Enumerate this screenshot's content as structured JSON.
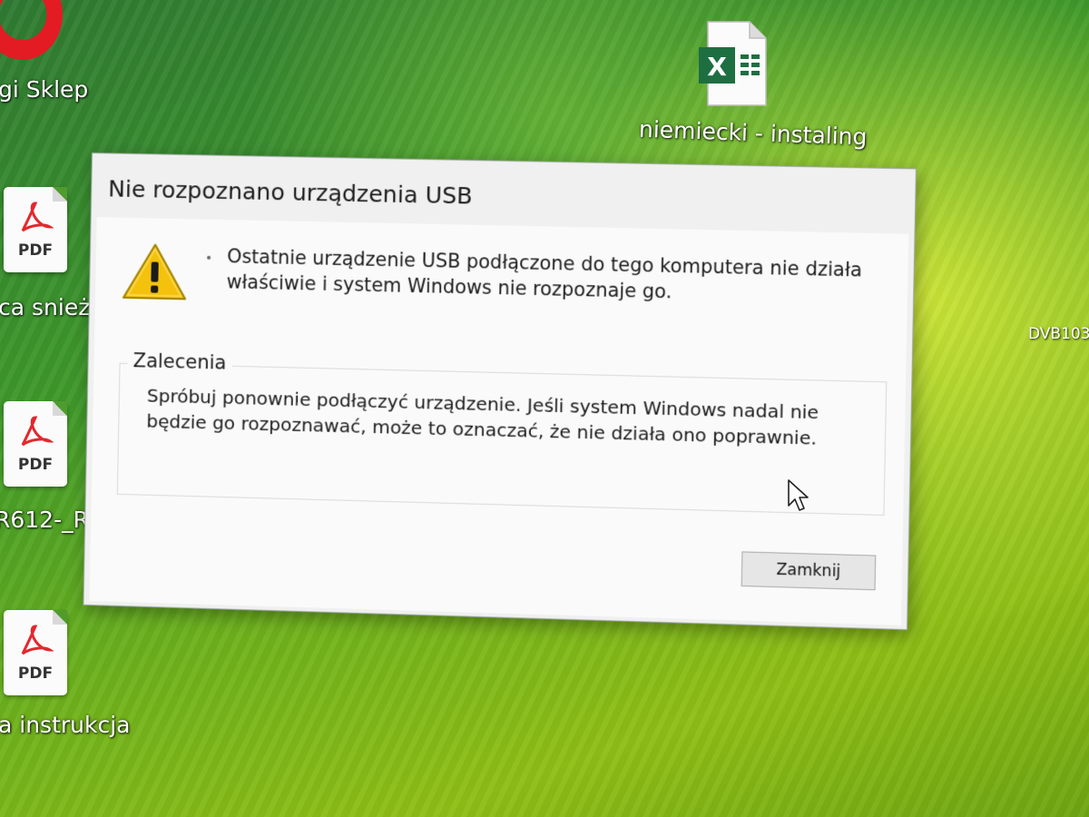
{
  "desktop": {
    "icons": [
      {
        "label": "gi Sklep"
      },
      {
        "label": "ca snież",
        "badge": "PDF"
      },
      {
        "label": "R612-_R-",
        "badge": "PDF"
      },
      {
        "label": "a instrukcja",
        "badge": "PDF"
      },
      {
        "label": "niemiecki - instaling",
        "badge": "X"
      },
      {
        "label": "DVB103"
      }
    ]
  },
  "dialog": {
    "title": "Nie rozpoznano urządzenia USB",
    "message": "Ostatnie urządzenie USB podłączone do tego komputera nie działa właściwie i system Windows nie rozpoznaje go.",
    "group_title": "Zalecenia",
    "recommendation": "Spróbuj ponownie podłączyć urządzenie. Jeśli system Windows nadal nie będzie go rozpoznawać, może to oznaczać, że nie działa ono poprawnie.",
    "close_label": "Zamknij"
  },
  "colors": {
    "warning_yellow": "#f4c20d",
    "pdf_red": "#e3282e",
    "excel_green": "#1d6f42"
  }
}
